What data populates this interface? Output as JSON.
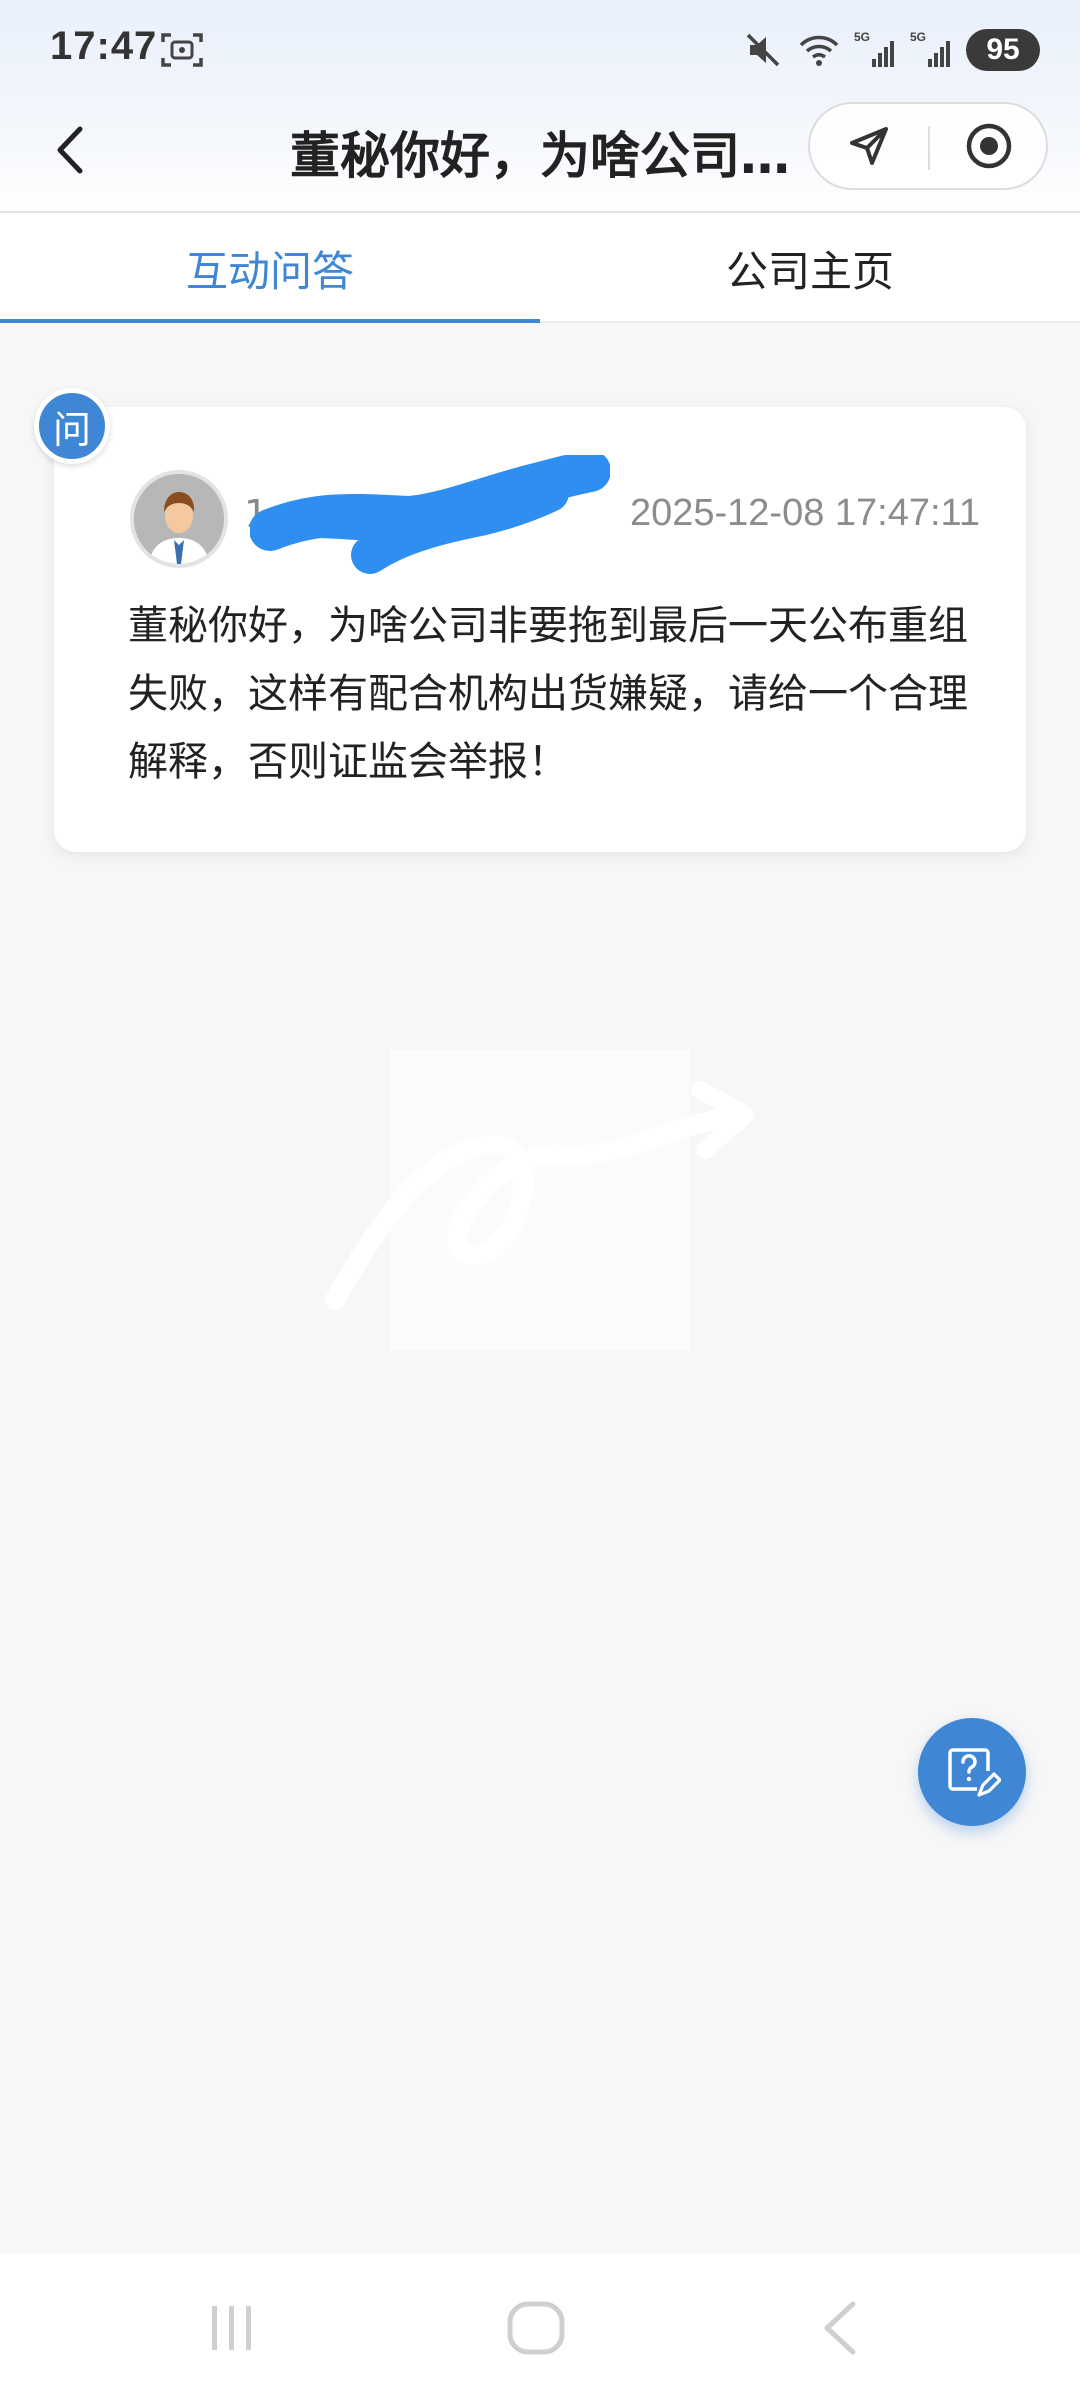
{
  "status_bar": {
    "time": "17:47",
    "battery": "95",
    "icons": [
      "screenshot-icon",
      "mute-icon",
      "wifi-icon",
      "signal-5g-icon",
      "signal-5g-icon"
    ],
    "signal_label": "5G"
  },
  "header": {
    "title": "董秘你好，为啥公司…",
    "back_icon": "chevron-left-icon",
    "share_icon": "send-icon",
    "close_icon": "target-icon"
  },
  "tabs": [
    {
      "label": "互动问答",
      "active": true
    },
    {
      "label": "公司主页",
      "active": false
    }
  ],
  "question": {
    "badge": "问",
    "username": "1",
    "timestamp": "2025-12-08 17:47:11",
    "text": "董秘你好，为啥公司非要拖到最后一天公布重组失败，这样有配合机构出货嫌疑，请给一个合理解释，否则证监会举报！"
  },
  "fab": {
    "icon": "ask-question-icon"
  },
  "nav": [
    "recent-apps-icon",
    "home-icon",
    "back-icon"
  ],
  "colors": {
    "accent": "#3f87d4",
    "redaction": "#2f8ff0",
    "badge_bg": "#3f87d4"
  }
}
